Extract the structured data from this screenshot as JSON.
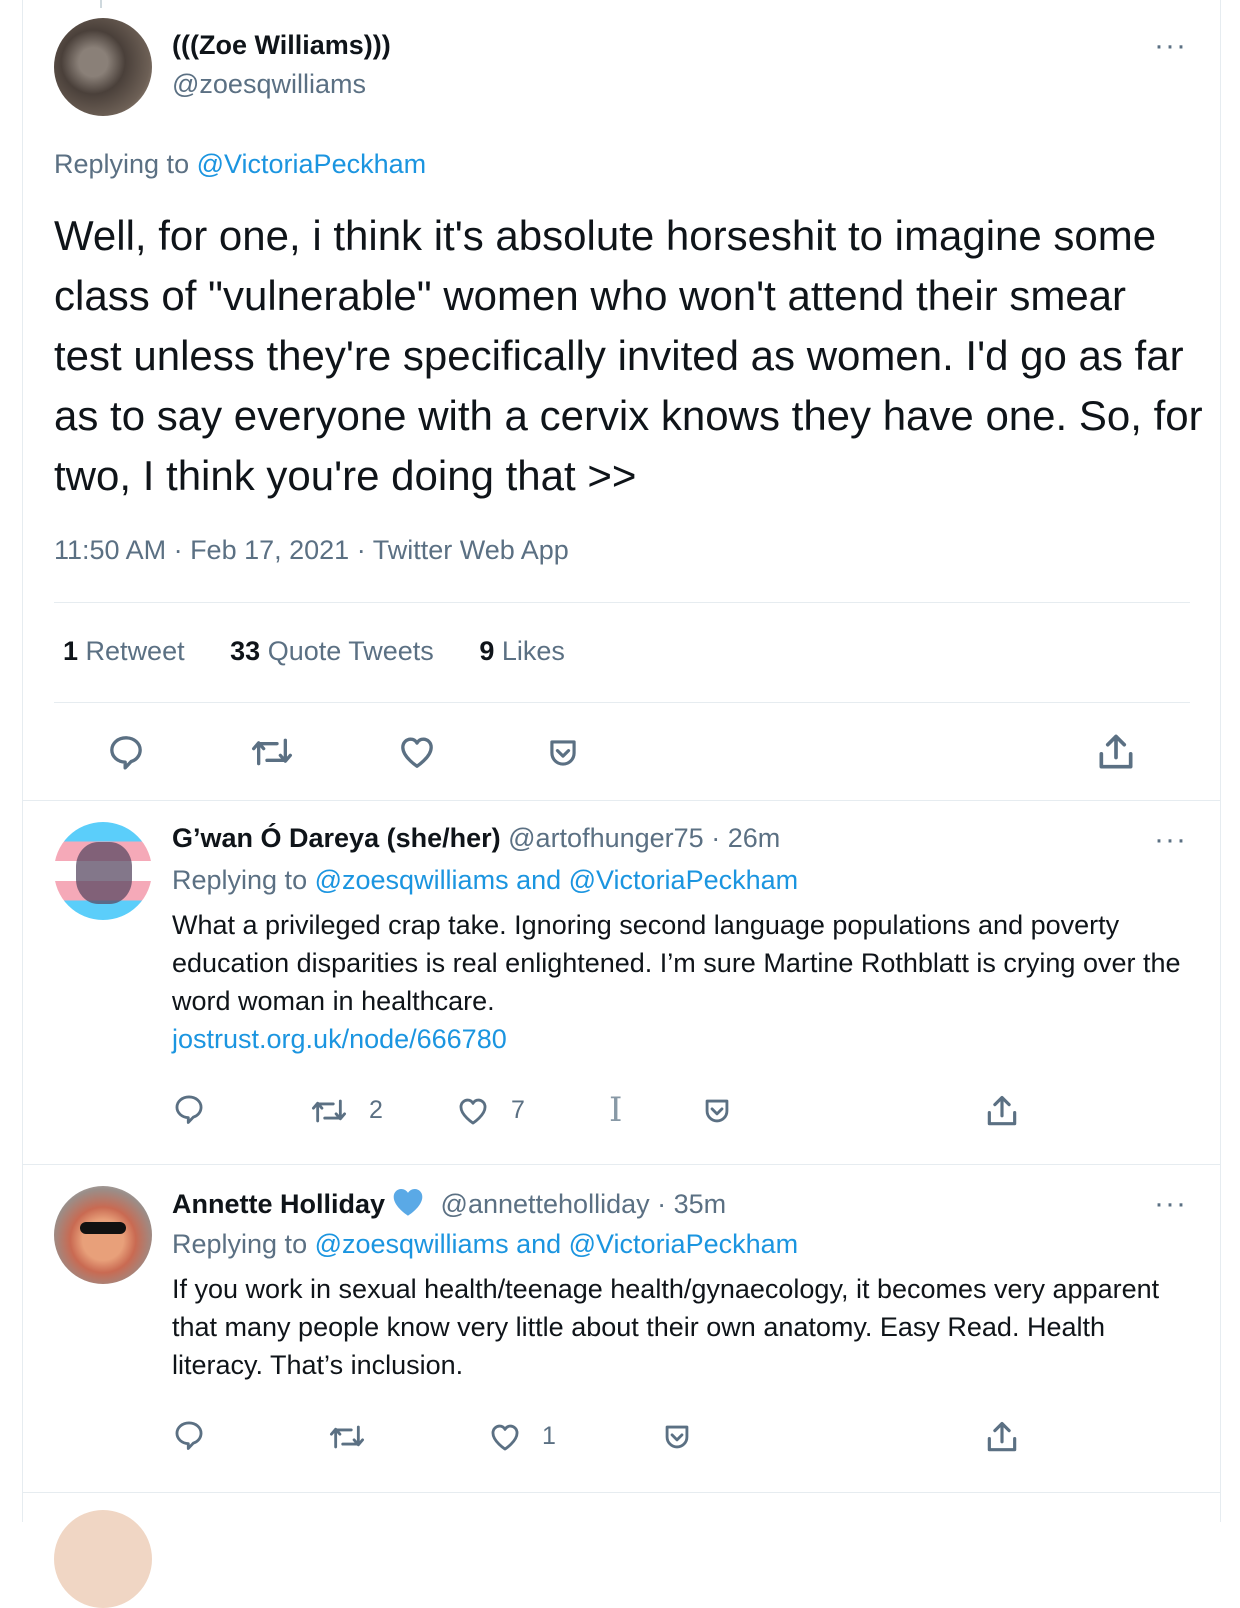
{
  "main_tweet": {
    "display_name": "(((Zoe Williams)))",
    "handle": "@zoesqwilliams",
    "replying_prefix": "Replying to",
    "replying_to": "@VictoriaPeckham",
    "text": "Well, for one, i think it's absolute horseshit to imagine some class of \"vulnerable\" women who won't attend their smear test unless they're specifically invited as women. I'd go as far as to say everyone with a cervix knows they have one. So, for two, I think you're doing that >>",
    "meta": "11:50 AM · Feb 17, 2021 · Twitter Web App",
    "stats": {
      "retweets_count": "1",
      "retweets_label": "Retweet",
      "quotes_count": "33",
      "quotes_label": "Quote Tweets",
      "likes_count": "9",
      "likes_label": "Likes"
    },
    "actions": [
      "reply-icon",
      "retweet-icon",
      "like-icon",
      "save-icon",
      "share-icon"
    ]
  },
  "replies": [
    {
      "display_name": "G’wan Ó Dareya (she/her)",
      "handle": "@artofhunger75",
      "time": "· 26m",
      "replying_prefix": "Replying to",
      "replying_to": "@zoesqwilliams and @VictoriaPeckham",
      "text": "What a privileged crap take. Ignoring second language populations and poverty education disparities is real enlightened. I’m sure Martine Rothblatt is crying over the word woman in healthcare.",
      "link": "jostrust.org.uk/node/666780",
      "retweets": "2",
      "likes": "7",
      "extra_icon": "I"
    },
    {
      "display_name": "Annette Holliday",
      "verified_icon": "heart-icon",
      "handle": "@annetteholliday",
      "time": "· 35m",
      "replying_prefix": "Replying to",
      "replying_to": "@zoesqwilliams and @VictoriaPeckham",
      "text": "If you work in sexual health/teenage health/gynaecology, it becomes very apparent that many people know very little about their own anatomy.  Easy Read. Health literacy.  That’s inclusion.",
      "likes": "1"
    }
  ],
  "more_label": "···",
  "colors": {
    "text": "#0f1419",
    "muted": "#5b7083",
    "link": "#1b95e0",
    "border": "#e6ecf0",
    "verified_heart": "#5aa9e6"
  }
}
